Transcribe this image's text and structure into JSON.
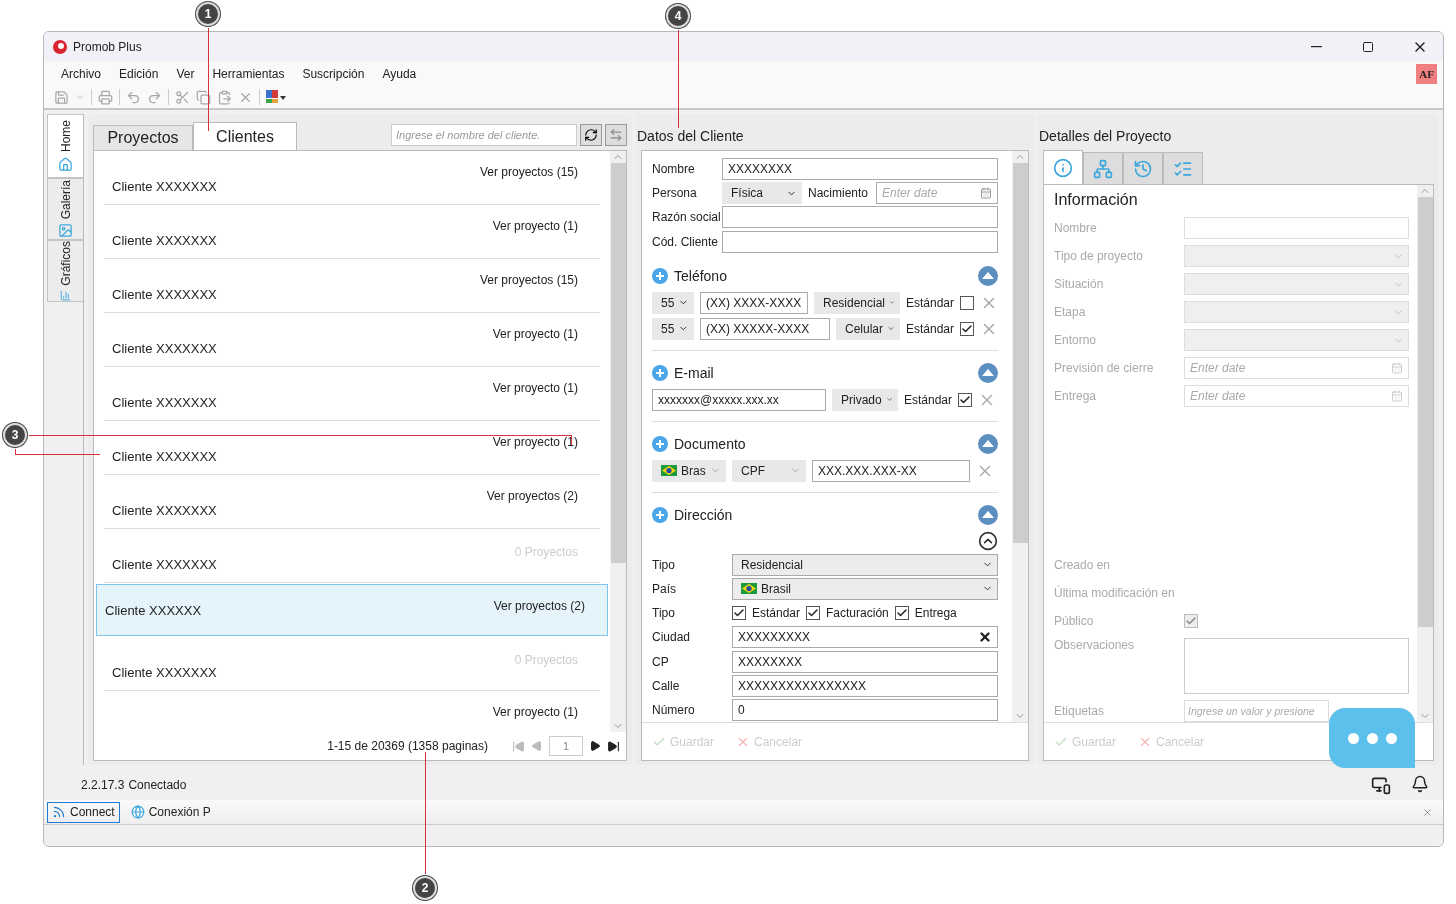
{
  "window": {
    "title": "Promob Plus"
  },
  "menu": [
    "Archivo",
    "Edición",
    "Ver",
    "Herramientas",
    "Suscripción",
    "Ayuda"
  ],
  "user_badge": "AF",
  "side_tabs": [
    {
      "label": "Home",
      "selected": true
    },
    {
      "label": "Galería",
      "selected": false
    },
    {
      "label": "Gráficos",
      "selected": false
    }
  ],
  "clients_panel": {
    "tabs": [
      {
        "label": "Proyectos",
        "selected": false
      },
      {
        "label": "Clientes",
        "selected": true
      }
    ],
    "search": {
      "placeholder": "Ingrese el nombre del cliente."
    },
    "rows": [
      {
        "name": "Cliente XXXXXXX",
        "projects": "Ver proyectos (15)",
        "disabled": false,
        "selected": false
      },
      {
        "name": "Cliente XXXXXXX",
        "projects": "Ver proyecto (1)",
        "disabled": false,
        "selected": false
      },
      {
        "name": "Cliente XXXXXXX",
        "projects": "Ver proyectos (15)",
        "disabled": false,
        "selected": false
      },
      {
        "name": "Cliente XXXXXXX",
        "projects": "Ver proyecto (1)",
        "disabled": false,
        "selected": false
      },
      {
        "name": "Cliente XXXXXXX",
        "projects": "Ver proyecto (1)",
        "disabled": false,
        "selected": false
      },
      {
        "name": "Cliente XXXXXXX",
        "projects": "Ver proyecto (1)",
        "disabled": false,
        "selected": false
      },
      {
        "name": "Cliente XXXXXXX",
        "projects": "Ver proyectos (2)",
        "disabled": false,
        "selected": false
      },
      {
        "name": "Cliente XXXXXXX",
        "projects": "0 Proyectos",
        "disabled": true,
        "selected": false
      },
      {
        "name": "Cliente XXXXXX",
        "projects": "Ver proyectos (2)",
        "disabled": false,
        "selected": true
      },
      {
        "name": "Cliente XXXXXXX",
        "projects": "0 Proyectos",
        "disabled": true,
        "selected": false
      },
      {
        "projects": "Ver proyecto (1)",
        "disabled": false,
        "selected": false
      }
    ],
    "pagination": {
      "summary": "1-15 de 20369 (1358 paginas)",
      "page": "1"
    }
  },
  "client_data": {
    "title": "Datos del Cliente",
    "nombre": {
      "label": "Nombre",
      "value": "XXXXXXXX"
    },
    "persona": {
      "label": "Persona",
      "value": "Física"
    },
    "nacimiento": {
      "label": "Nacimiento",
      "placeholder": "Enter date"
    },
    "razon_social": {
      "label": "Razón social"
    },
    "codigo": {
      "label": "Cód. Cliente"
    },
    "telefono": {
      "title": "Teléfono",
      "rows": [
        {
          "code": "55",
          "number": "(XX) XXXX-XXXX",
          "type": "Residencial",
          "standard": "Estándar",
          "checked": false
        },
        {
          "code": "55",
          "number": "(XX) XXXXX-XXXX",
          "type": "Celular",
          "standard": "Estándar",
          "checked": true
        }
      ]
    },
    "email": {
      "title": "E-mail",
      "rows": [
        {
          "address": "xxxxxxx@xxxxx.xxx.xx",
          "type": "Privado",
          "standard": "Estándar",
          "checked": true
        }
      ]
    },
    "documento": {
      "title": "Documento",
      "rows": [
        {
          "country": "Bras",
          "type": "CPF",
          "number": "XXX.XXX.XXX-XX"
        }
      ]
    },
    "direccion": {
      "title": "Dirección",
      "tipo": {
        "label": "Tipo",
        "value": "Residencial"
      },
      "pais": {
        "label": "País",
        "value": "Brasil"
      },
      "uso": {
        "label": "Tipo",
        "options": [
          {
            "label": "Estándar",
            "checked": true
          },
          {
            "label": "Facturación",
            "checked": true
          },
          {
            "label": "Entrega",
            "checked": true
          }
        ]
      },
      "fields": [
        {
          "label": "Ciudad",
          "value": "XXXXXXXXX",
          "clearable": true
        },
        {
          "label": "CP",
          "value": "XXXXXXXX",
          "clearable": false
        },
        {
          "label": "Calle",
          "value": "XXXXXXXXXXXXXXXX",
          "clearable": false
        },
        {
          "label": "Número",
          "value": "0",
          "clearable": false
        }
      ]
    },
    "buttons": [
      {
        "label": "Guardar",
        "kind": "save",
        "disabled": true
      },
      {
        "label": "Cancelar",
        "kind": "cancel",
        "disabled": true
      }
    ]
  },
  "project_details": {
    "title": "Detalles del Proyecto",
    "tabs": [
      {
        "kind": "info",
        "selected": true
      },
      {
        "kind": "tree",
        "selected": false
      },
      {
        "kind": "history",
        "selected": false
      },
      {
        "kind": "checklist",
        "selected": false
      }
    ],
    "heading": "Información",
    "fields": [
      {
        "label": "Nombre",
        "kind": "text"
      },
      {
        "label": "Tipo de proyecto",
        "kind": "select"
      },
      {
        "label": "Situación",
        "kind": "select"
      },
      {
        "label": "Etapa",
        "kind": "select"
      },
      {
        "label": "Entorno",
        "kind": "select"
      },
      {
        "label": "Previsión de cierre",
        "kind": "date",
        "placeholder": "Enter date"
      },
      {
        "label": "Entrega",
        "kind": "date",
        "placeholder": "Enter date"
      }
    ],
    "meta": [
      {
        "label": "Creado en"
      },
      {
        "label": "Última modificación en"
      }
    ],
    "publico": {
      "label": "Público",
      "checked": true
    },
    "observaciones": {
      "label": "Observaciones"
    },
    "etiquetas": {
      "label": "Etiquetas",
      "placeholder": "Ingrese un valor y presione"
    },
    "buttons": [
      {
        "label": "Guardar",
        "kind": "save",
        "disabled": true
      },
      {
        "label": "Cancelar",
        "kind": "cancel",
        "disabled": true
      }
    ]
  },
  "status": {
    "version": "2.2.17.3",
    "state": "Conectado"
  },
  "taskbar": [
    {
      "label": "Connect",
      "kind": "rss",
      "selected": true
    },
    {
      "label": "Conexión P",
      "kind": "globe",
      "selected": false
    }
  ],
  "callouts": [
    {
      "number": "1"
    },
    {
      "number": "4"
    },
    {
      "number": "3"
    },
    {
      "number": "2"
    }
  ]
}
